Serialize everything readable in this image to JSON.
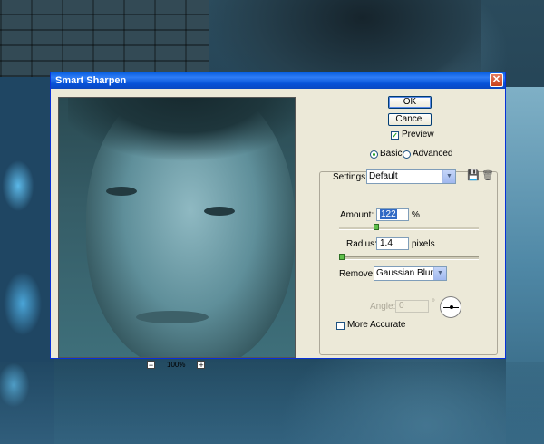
{
  "dialog": {
    "title": "Smart Sharpen",
    "close_glyph": "✕"
  },
  "buttons": {
    "ok": "OK",
    "cancel": "Cancel"
  },
  "preview": {
    "label": "Preview",
    "checked": true,
    "zoom_out": "−",
    "zoom_in": "+",
    "zoom_level": "100%"
  },
  "mode": {
    "basic": "Basic",
    "advanced": "Advanced",
    "selected": "Basic"
  },
  "settings": {
    "label": "Settings:",
    "value": "Default",
    "save_icon": "save-preset-icon",
    "delete_icon": "trash-icon"
  },
  "amount": {
    "label": "Amount:",
    "value": "122",
    "unit": "%",
    "slider_fraction": 0.244
  },
  "radius": {
    "label": "Radius:",
    "value": "1.4",
    "unit": "pixels",
    "slider_fraction": 0.0
  },
  "remove": {
    "label": "Remove:",
    "value": "Gaussian Blur"
  },
  "angle": {
    "label": "Angle:",
    "value": "0",
    "unit": "°"
  },
  "more_accurate": {
    "label": "More Accurate",
    "checked": false
  }
}
